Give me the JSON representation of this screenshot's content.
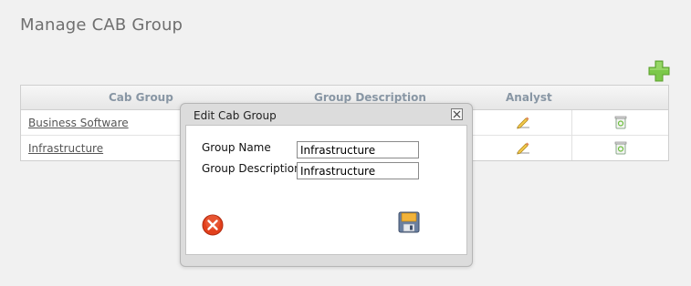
{
  "page": {
    "title": "Manage CAB Group"
  },
  "toolbar": {
    "add_icon": "add-plus-icon",
    "accent": "#6cbf3c"
  },
  "grid": {
    "columns": [
      "Cab Group",
      "Group Description",
      "Analyst"
    ],
    "rows": [
      {
        "name": "Business Software",
        "edit_icon": "edit-pencil-icon",
        "delete_icon": "delete-bin-icon"
      },
      {
        "name": "Infrastructure",
        "edit_icon": "edit-pencil-icon",
        "delete_icon": "delete-bin-icon"
      }
    ]
  },
  "modal": {
    "title": "Edit Cab Group",
    "group_name_label": "Group Name",
    "group_name_value": "Infrastructure",
    "group_description_label": "Group Description",
    "group_description_value": "Infrastructure",
    "cancel_icon": "cancel-x-icon",
    "save_icon": "save-floppy-icon",
    "cancel_color": "#e2401c"
  }
}
